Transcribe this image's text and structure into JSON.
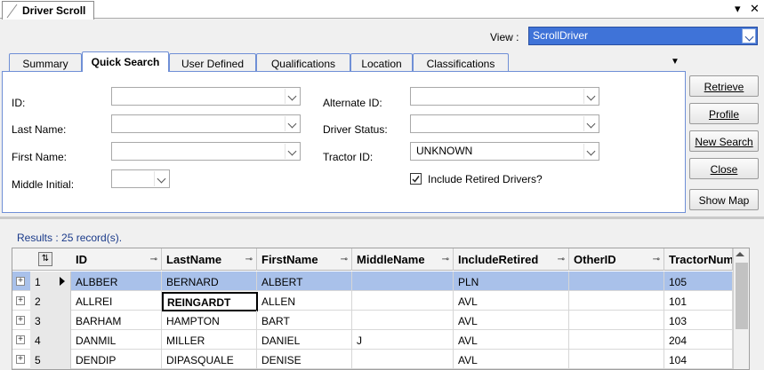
{
  "window": {
    "title": "Driver Scroll"
  },
  "view": {
    "label": "View :",
    "value": "ScrollDriver"
  },
  "tabs": [
    {
      "label": "Summary"
    },
    {
      "label": "Quick Search"
    },
    {
      "label": "User Defined"
    },
    {
      "label": "Qualifications"
    },
    {
      "label": "Location"
    },
    {
      "label": "Classifications"
    }
  ],
  "form": {
    "id_label": "ID:",
    "last_name_label": "Last Name:",
    "first_name_label": "First Name:",
    "middle_initial_label": "Middle Initial:",
    "alternate_id_label": "Alternate ID:",
    "driver_status_label": "Driver Status:",
    "tractor_id_label": "Tractor ID:",
    "tractor_id_value": "UNKNOWN",
    "include_retired_label": "Include Retired Drivers?"
  },
  "buttons": {
    "retrieve": "Retrieve",
    "profile": "Profile",
    "new_search": "New Search",
    "close": "Close",
    "show_map": "Show Map"
  },
  "results": {
    "text": "Results : 25 record(s)."
  },
  "grid": {
    "columns": [
      "ID",
      "LastName",
      "FirstName",
      "MiddleName",
      "IncludeRetired",
      "OtherID",
      "TractorNum"
    ],
    "rows": [
      {
        "num": "1",
        "id": "ALBBER",
        "last": "BERNARD",
        "first": "ALBERT",
        "middle": "",
        "retired": "PLN",
        "other": "",
        "tractor": "105"
      },
      {
        "num": "2",
        "id": "ALLREI",
        "last": "REINGARDT",
        "first": "ALLEN",
        "middle": "",
        "retired": "AVL",
        "other": "",
        "tractor": "101"
      },
      {
        "num": "3",
        "id": "BARHAM",
        "last": "HAMPTON",
        "first": "BART",
        "middle": "",
        "retired": "AVL",
        "other": "",
        "tractor": "103"
      },
      {
        "num": "4",
        "id": "DANMIL",
        "last": "MILLER",
        "first": "DANIEL",
        "middle": "J",
        "retired": "AVL",
        "other": "",
        "tractor": "204"
      },
      {
        "num": "5",
        "id": "DENDIP",
        "last": "DIPASQUALE",
        "first": "DENISE",
        "middle": "",
        "retired": "AVL",
        "other": "",
        "tractor": "104"
      }
    ]
  },
  "colors": {
    "accent": "#3f73d8",
    "selected_row": "#a9c1ea",
    "tab_border": "#6f8fd6"
  }
}
